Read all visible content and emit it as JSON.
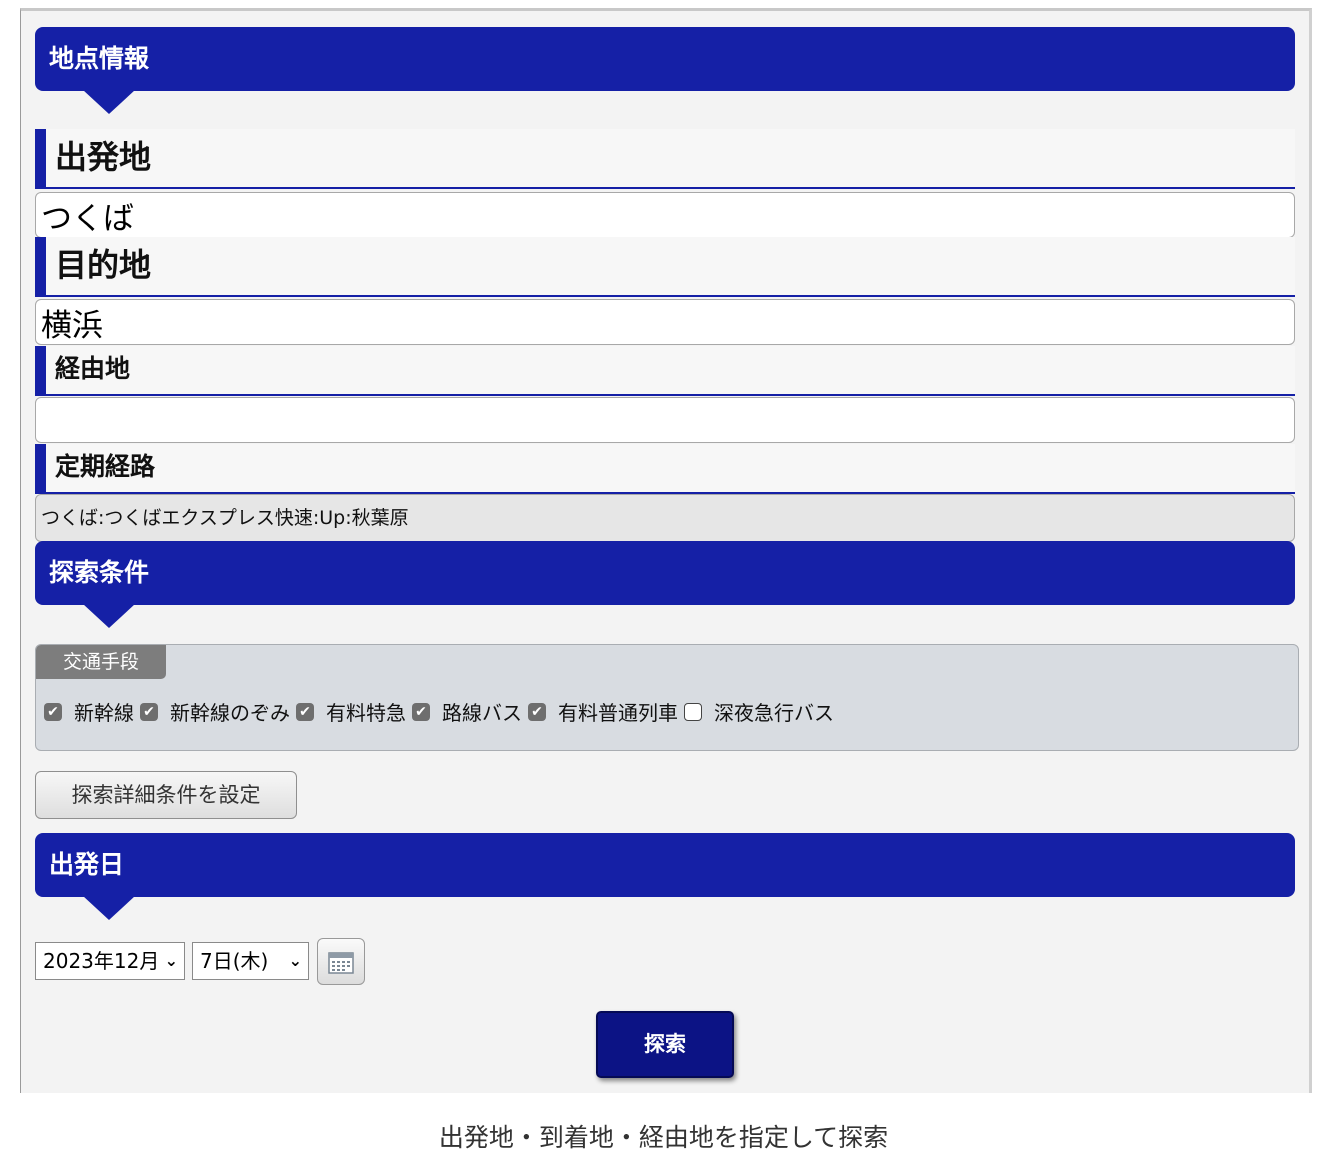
{
  "sections": {
    "location": {
      "title": "地点情報"
    },
    "conditions": {
      "title": "探索条件"
    },
    "date": {
      "title": "出発日"
    }
  },
  "fields": {
    "departure": {
      "label": "出発地",
      "value": "つくば"
    },
    "destination": {
      "label": "目的地",
      "value": "横浜"
    },
    "via": {
      "label": "経由地",
      "value": ""
    },
    "commuter_route": {
      "label": "定期経路",
      "value": "つくば:つくばエクスプレス快速:Up:秋葉原"
    }
  },
  "transport": {
    "title": "交通手段",
    "options": [
      {
        "label": "新幹線",
        "checked": true
      },
      {
        "label": "新幹線のぞみ",
        "checked": true
      },
      {
        "label": "有料特急",
        "checked": true
      },
      {
        "label": "路線バス",
        "checked": true
      },
      {
        "label": "有料普通列車",
        "checked": true
      },
      {
        "label": "深夜急行バス",
        "checked": false
      }
    ]
  },
  "detail_button": {
    "label": "探索詳細条件を設定"
  },
  "date_select": {
    "month": "2023年12月",
    "day": "7日(木)"
  },
  "icons": {
    "calendar": "calendar-icon",
    "chevron": "chevron-down-icon",
    "check": "check-icon"
  },
  "search_button": {
    "label": "探索"
  },
  "caption": "出発地・到着地・経由地を指定して探索",
  "colors": {
    "accent": "#1520a6",
    "button": "#0c1385",
    "transport_box": "#d8dce1"
  }
}
